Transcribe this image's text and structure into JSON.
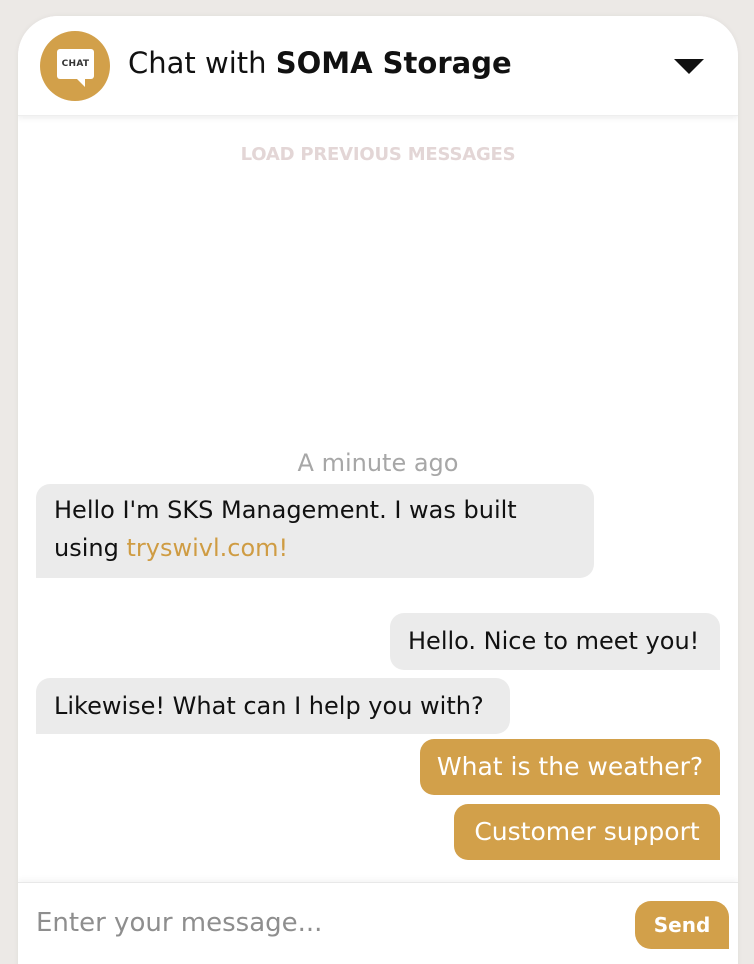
{
  "header": {
    "avatar_text": "CHAT",
    "title_prefix": "Chat with ",
    "title_name": "SOMA Storage"
  },
  "load_previous": "LOAD PREVIOUS MESSAGES",
  "timestamp": "A minute ago",
  "messages": [
    {
      "from": "bot",
      "text": "Hello I'm SKS Management. I was built using ",
      "link": "tryswivl.com!"
    },
    {
      "from": "user",
      "text": "Hello. Nice to meet you!"
    },
    {
      "from": "bot",
      "text": "Likewise! What can I help you with?"
    }
  ],
  "quick_replies": [
    "What is the weather?",
    "Customer support"
  ],
  "composer": {
    "placeholder": "Enter your message...",
    "send_label": "Send"
  },
  "colors": {
    "accent": "#d2a04a",
    "link": "#cf9c43",
    "bubble_bg": "#ebebeb"
  }
}
